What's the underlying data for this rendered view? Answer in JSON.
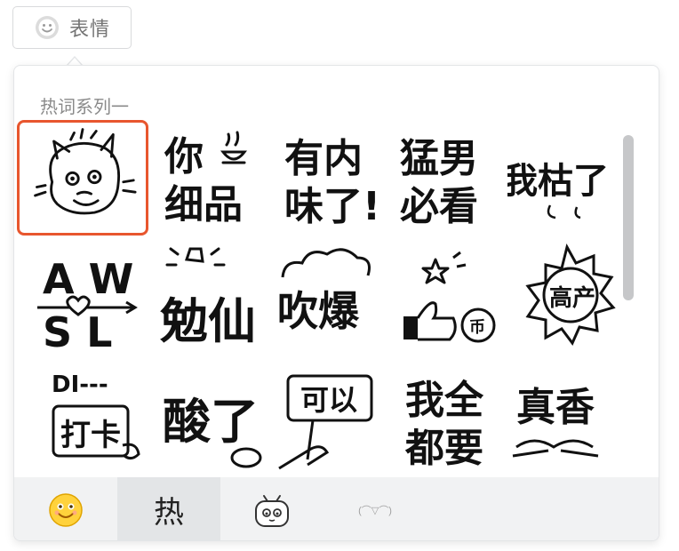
{
  "trigger": {
    "label": "表情",
    "icon": "smile-icon"
  },
  "panel": {
    "package_title": "热词系列一",
    "stickers": [
      {
        "name": "cat-face",
        "lines": [],
        "selected": true
      },
      {
        "name": "ni-xi-pin",
        "lines": [
          "你",
          "细品"
        ]
      },
      {
        "name": "you-nei-wei-le",
        "lines": [
          "有内",
          "味了!"
        ]
      },
      {
        "name": "meng-nan-bi-kan",
        "lines": [
          "猛男",
          "必看"
        ]
      },
      {
        "name": "wo-suan-le",
        "lines": [
          "我枯了"
        ]
      },
      {
        "name": "awsl",
        "lines": [
          "A W",
          "S L"
        ]
      },
      {
        "name": "xian-jia",
        "lines": [
          "勉仙"
        ]
      },
      {
        "name": "chui-bao",
        "lines": [
          "吹爆"
        ]
      },
      {
        "name": "toubi",
        "lines": [
          "币"
        ]
      },
      {
        "name": "gao-chan",
        "lines": [
          "高产"
        ]
      },
      {
        "name": "di-daka",
        "lines": [
          "DI---",
          "打卡"
        ]
      },
      {
        "name": "suan-le",
        "lines": [
          "酸了"
        ]
      },
      {
        "name": "ke-yi",
        "lines": [
          "可以"
        ]
      },
      {
        "name": "wo-quan-dou-yao",
        "lines": [
          "我全",
          "都要"
        ]
      },
      {
        "name": "zhen-xiang",
        "lines": [
          "真香"
        ]
      }
    ]
  },
  "tabs": [
    {
      "name": "tab-emoji",
      "icon": "smiley-face-icon"
    },
    {
      "name": "tab-hot",
      "label": "热",
      "active": true
    },
    {
      "name": "tab-tv",
      "icon": "tv-mascot-icon"
    },
    {
      "name": "tab-kaomoji",
      "label": "(⌒▽⌒)"
    }
  ]
}
